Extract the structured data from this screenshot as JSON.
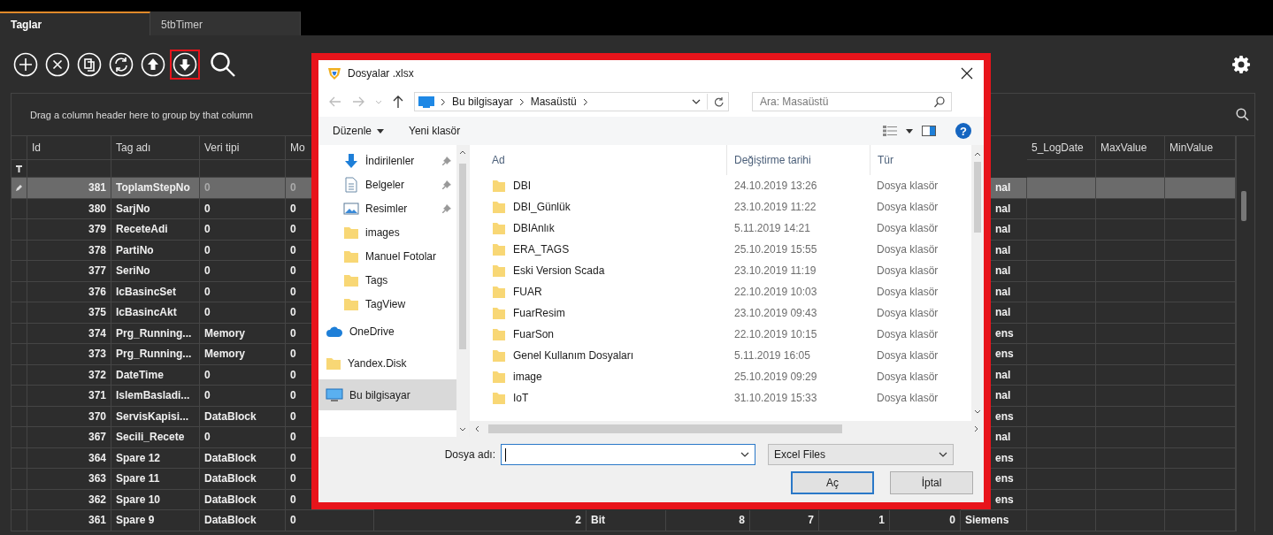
{
  "tabs": [
    {
      "label": "Taglar",
      "selected": true
    },
    {
      "label": "5tbTimer",
      "selected": false
    }
  ],
  "toolbar": {
    "buttons": [
      {
        "kind": "add",
        "highlighted": false
      },
      {
        "kind": "delete",
        "highlighted": false
      },
      {
        "kind": "copy",
        "highlighted": false
      },
      {
        "kind": "refresh",
        "highlighted": false
      },
      {
        "kind": "upload",
        "highlighted": false
      },
      {
        "kind": "download",
        "highlighted": true
      },
      {
        "kind": "search",
        "highlighted": false
      }
    ]
  },
  "group_panel": {
    "hint": "Drag a column header here to group by that column"
  },
  "grid": {
    "columns_left": [
      "Id",
      "Tag adı",
      "Veri tipi",
      "Mo"
    ],
    "columns_right": [
      "5_LogDate",
      "MaxValue",
      "MinValue"
    ],
    "rows": [
      {
        "kind": "covered",
        "id": "381",
        "tag": "ToplamStepNo",
        "type": "0",
        "mod": "0",
        "tail": "nal",
        "selected": true
      },
      {
        "kind": "covered",
        "id": "380",
        "tag": "SarjNo",
        "type": "0",
        "mod": "0",
        "tail": "nal",
        "selected": false
      },
      {
        "kind": "covered",
        "id": "379",
        "tag": "ReceteAdi",
        "type": "0",
        "mod": "0",
        "tail": "nal",
        "selected": false
      },
      {
        "kind": "covered",
        "id": "378",
        "tag": "PartiNo",
        "type": "0",
        "mod": "0",
        "tail": "nal",
        "selected": false
      },
      {
        "kind": "covered",
        "id": "377",
        "tag": "SeriNo",
        "type": "0",
        "mod": "0",
        "tail": "nal",
        "selected": false
      },
      {
        "kind": "covered",
        "id": "376",
        "tag": "IcBasincSet",
        "type": "0",
        "mod": "0",
        "tail": "nal",
        "selected": false
      },
      {
        "kind": "covered",
        "id": "375",
        "tag": "IcBasincAkt",
        "type": "0",
        "mod": "0",
        "tail": "nal",
        "selected": false
      },
      {
        "kind": "covered",
        "id": "374",
        "tag": "Prg_Running...",
        "type": "Memory",
        "mod": "0",
        "tail": "ens",
        "selected": false
      },
      {
        "kind": "covered",
        "id": "373",
        "tag": "Prg_Running...",
        "type": "Memory",
        "mod": "0",
        "tail": "ens",
        "selected": false
      },
      {
        "kind": "covered",
        "id": "372",
        "tag": "DateTime",
        "type": "0",
        "mod": "0",
        "tail": "nal",
        "selected": false
      },
      {
        "kind": "covered",
        "id": "371",
        "tag": "IslemBasladi...",
        "type": "0",
        "mod": "0",
        "tail": "nal",
        "selected": false
      },
      {
        "kind": "covered",
        "id": "370",
        "tag": "ServisKapisi...",
        "type": "DataBlock",
        "mod": "0",
        "tail": "ens",
        "selected": false
      },
      {
        "kind": "covered",
        "id": "367",
        "tag": "Secili_Recete",
        "type": "0",
        "mod": "0",
        "tail": "nal",
        "selected": false
      },
      {
        "kind": "covered",
        "id": "364",
        "tag": "Spare 12",
        "type": "DataBlock",
        "mod": "0",
        "tail": "ens",
        "selected": false
      },
      {
        "kind": "covered",
        "id": "363",
        "tag": "Spare 11",
        "type": "DataBlock",
        "mod": "0",
        "tail": "ens",
        "selected": false
      },
      {
        "kind": "covered",
        "id": "362",
        "tag": "Spare 10",
        "type": "DataBlock",
        "mod": "0",
        "tail": "ens",
        "selected": false
      },
      {
        "kind": "full",
        "id": "361",
        "tag": "Spare 9",
        "type": "DataBlock",
        "mod": "0",
        "cells": [
          "2",
          "Bit",
          "8",
          "7",
          "1",
          "0"
        ],
        "tail": "Siemens",
        "selected": false
      }
    ]
  },
  "dialog": {
    "title": "Dosyalar .xlsx",
    "breadcrumb": [
      "Bu bilgisayar",
      "Masaüstü"
    ],
    "search": {
      "placeholder": "Ara: Masaüstü"
    },
    "commands": [
      "Düzenle",
      "Yeni klasör"
    ],
    "help": "?",
    "quick_access": [
      {
        "kind": "download",
        "label": "İndirilenler",
        "pinned": true
      },
      {
        "kind": "document",
        "label": "Belgeler",
        "pinned": true
      },
      {
        "kind": "picture",
        "label": "Resimler",
        "pinned": true
      },
      {
        "kind": "folder",
        "label": "images",
        "pinned": false
      },
      {
        "kind": "folder",
        "label": "Manuel Fotolar",
        "pinned": false
      },
      {
        "kind": "folder",
        "label": "Tags",
        "pinned": false
      },
      {
        "kind": "folder",
        "label": "TagView",
        "pinned": false
      }
    ],
    "locations": [
      {
        "kind": "cloud",
        "label": "OneDrive",
        "selected": false
      },
      {
        "kind": "folder",
        "label": "Yandex.Disk",
        "selected": false
      },
      {
        "kind": "computer",
        "label": "Bu bilgisayar",
        "selected": true
      }
    ],
    "columns": [
      "Ad",
      "Değiştirme tarihi",
      "Tür"
    ],
    "files": [
      {
        "name": "DBI",
        "date": "24.10.2019 13:26",
        "type": "Dosya klasör"
      },
      {
        "name": "DBI_Günlük",
        "date": "23.10.2019 11:22",
        "type": "Dosya klasör"
      },
      {
        "name": "DBIAnlık",
        "date": "5.11.2019 14:21",
        "type": "Dosya klasör"
      },
      {
        "name": "ERA_TAGS",
        "date": "25.10.2019 15:55",
        "type": "Dosya klasör"
      },
      {
        "name": "Eski Version Scada",
        "date": "23.10.2019 11:19",
        "type": "Dosya klasör"
      },
      {
        "name": "FUAR",
        "date": "22.10.2019 10:03",
        "type": "Dosya klasör"
      },
      {
        "name": "FuarResim",
        "date": "23.10.2019 09:43",
        "type": "Dosya klasör"
      },
      {
        "name": "FuarSon",
        "date": "22.10.2019 10:15",
        "type": "Dosya klasör"
      },
      {
        "name": "Genel Kullanım Dosyaları",
        "date": "5.11.2019 16:05",
        "type": "Dosya klasör"
      },
      {
        "name": "image",
        "date": "25.10.2019 09:29",
        "type": "Dosya klasör"
      },
      {
        "name": "IoT",
        "date": "31.10.2019 15:33",
        "type": "Dosya klasör"
      }
    ],
    "filename_label": "Dosya adı:",
    "filter": "Excel Files",
    "buttons": [
      "Aç",
      "İptal"
    ]
  }
}
